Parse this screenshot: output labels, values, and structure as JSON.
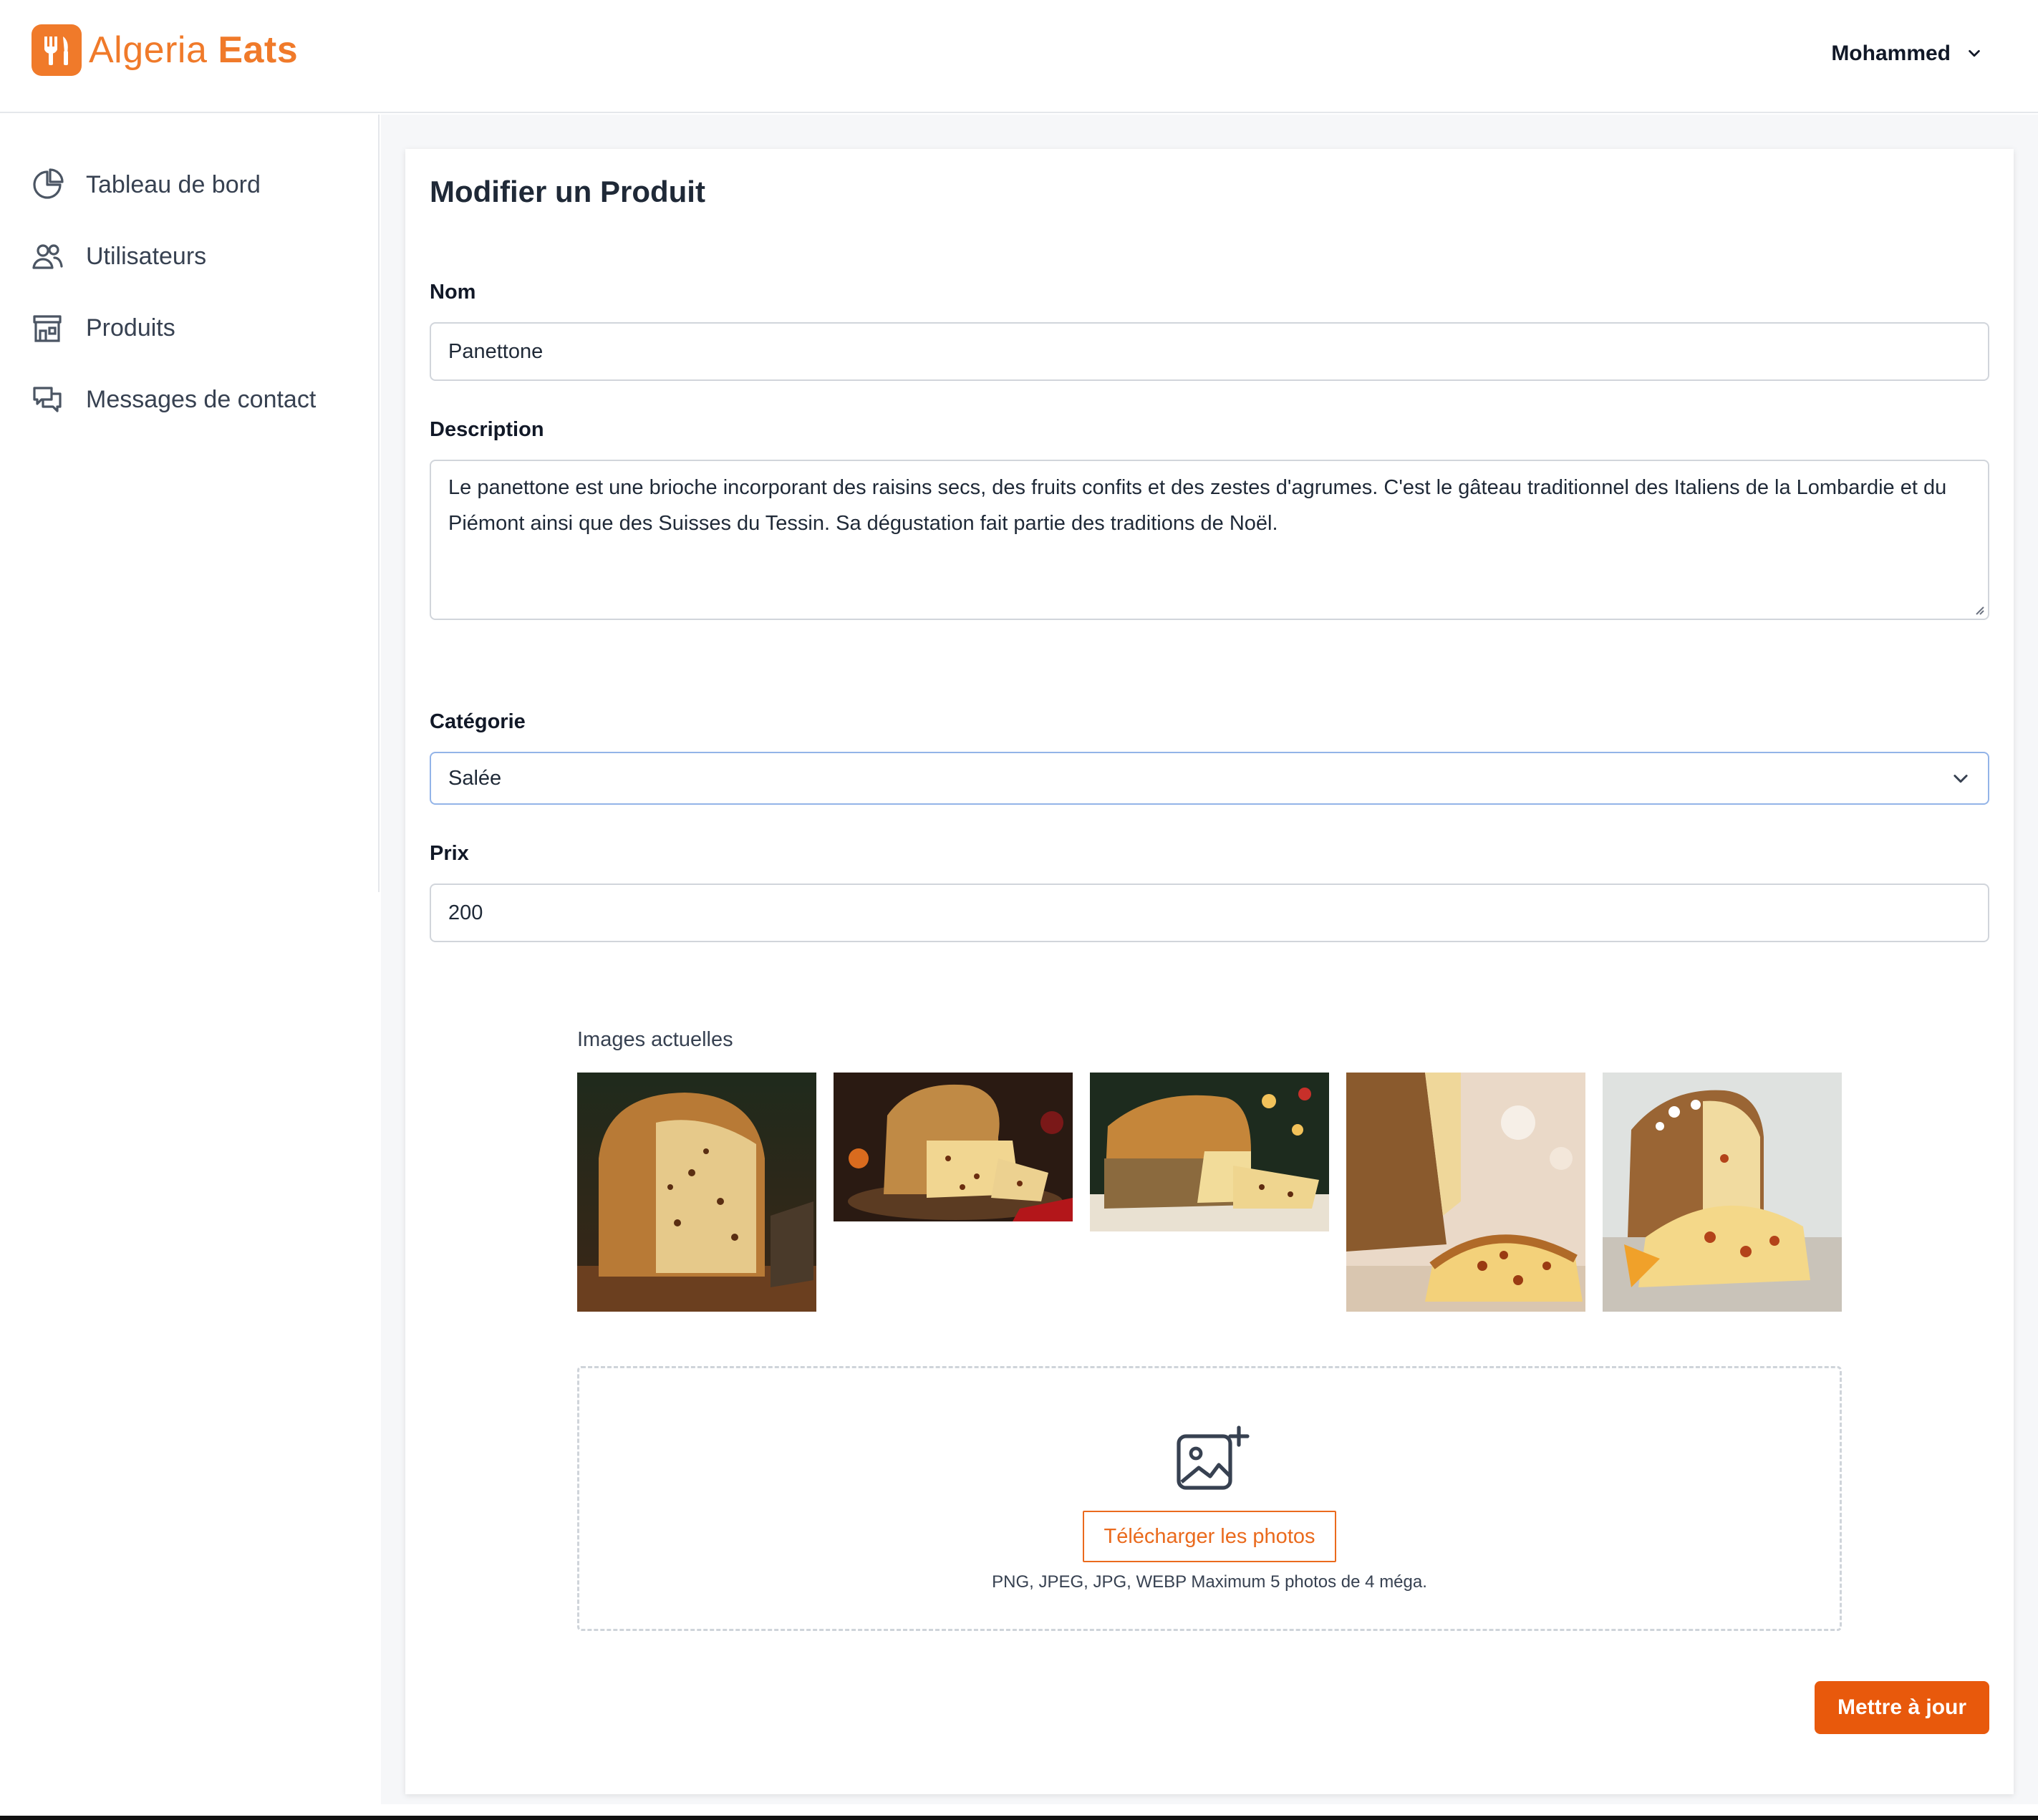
{
  "brand": {
    "name_regular": "Algeria",
    "name_bold": "Eats",
    "color": "#f07a2a"
  },
  "header": {
    "user_name": "Mohammed"
  },
  "sidebar": {
    "items": [
      {
        "label": "Tableau de bord",
        "icon": "pie-chart-icon"
      },
      {
        "label": "Utilisateurs",
        "icon": "users-icon"
      },
      {
        "label": "Produits",
        "icon": "store-icon"
      },
      {
        "label": "Messages de contact",
        "icon": "chat-icon"
      }
    ]
  },
  "form": {
    "title": "Modifier un Produit",
    "name": {
      "label": "Nom",
      "value": "Panettone"
    },
    "description": {
      "label": "Description",
      "value": "Le panettone est une brioche incorporant des raisins secs, des fruits confits et des zestes d'agrumes. C'est le gâteau traditionnel des Italiens de la Lombardie et du Piémont ainsi que des Suisses du Tessin. Sa dégustation fait partie des traditions de Noël."
    },
    "category": {
      "label": "Catégorie",
      "value": "Salée"
    },
    "price": {
      "label": "Prix",
      "value": "200"
    },
    "images": {
      "label": "Images actuelles",
      "count": 5
    },
    "upload": {
      "button_label": "Télécharger les photos",
      "hint": "PNG, JPEG, JPG, WEBP Maximum 5 photos de 4 méga."
    },
    "submit_label": "Mettre à jour"
  },
  "colors": {
    "accent": "#e8590c",
    "upload_accent": "#ea6a1d",
    "select_focus_border": "#93b4e8"
  }
}
